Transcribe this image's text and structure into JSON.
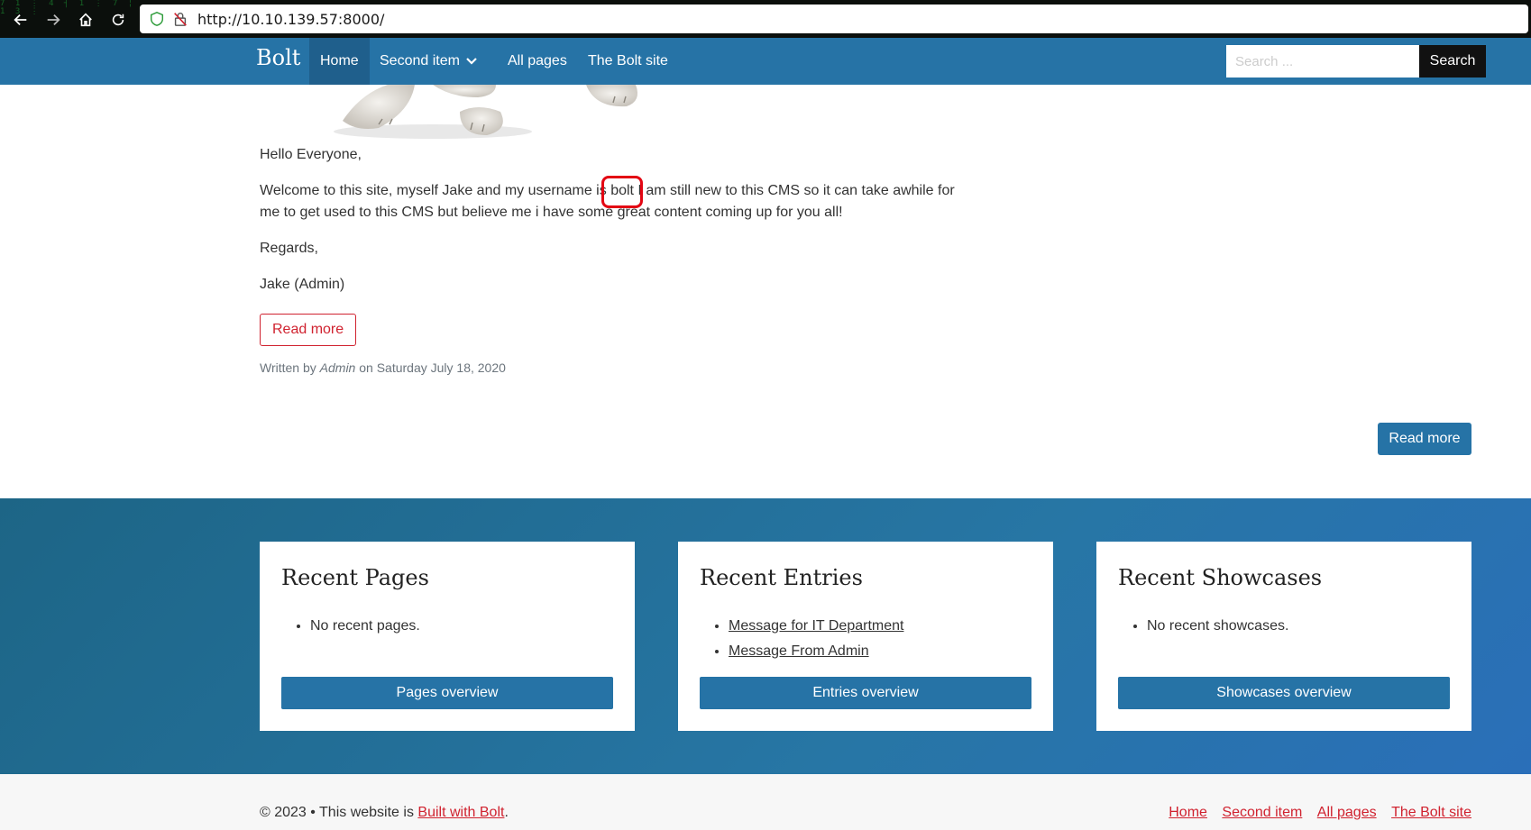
{
  "browser": {
    "url": "http://10.10.139.57:8000/",
    "matrix_text": "7 1 ⋮ 4 ┤ 1 ⋮ 7 ¦ 1 3 ⋮"
  },
  "navbar": {
    "brand": "Bolt",
    "items": [
      {
        "label": "Home",
        "active": true
      },
      {
        "label": "Second item",
        "dropdown": true
      },
      {
        "label": "All pages"
      },
      {
        "label": "The Bolt site"
      }
    ],
    "search_placeholder": "Search ...",
    "search_button": "Search"
  },
  "article": {
    "greeting": "Hello Everyone,",
    "body_before": "Welcome to this site, myself Jake and my username is ",
    "username": "bolt",
    "body_after": " I am still new to this CMS so it can take awhile for me to get used to this CMS but believe me i have some great content coming up for you all!",
    "regards": "Regards,",
    "signature": "Jake (Admin)",
    "read_more": "Read more",
    "meta_prefix": "Written by ",
    "meta_author": "Admin",
    "meta_suffix": " on Saturday July 18, 2020"
  },
  "read_more_right": "Read more",
  "widgets": {
    "pages": {
      "title": "Recent Pages",
      "items": [
        "No recent pages."
      ],
      "button": "Pages overview"
    },
    "entries": {
      "title": "Recent Entries",
      "items": [
        "Message for IT Department",
        "Message From Admin"
      ],
      "button": "Entries overview"
    },
    "showcases": {
      "title": "Recent Showcases",
      "items": [
        "No recent showcases."
      ],
      "button": "Showcases overview"
    }
  },
  "footer": {
    "copy_prefix": "© 2023 • This website is ",
    "copy_link": "Built with Bolt",
    "copy_suffix": ".",
    "links": [
      "Home",
      "Second item",
      "All pages",
      "The Bolt site"
    ]
  },
  "colors": {
    "brand_blue": "#2673a6",
    "accent_red": "#d0222f",
    "highlight_red": "#e30613"
  }
}
